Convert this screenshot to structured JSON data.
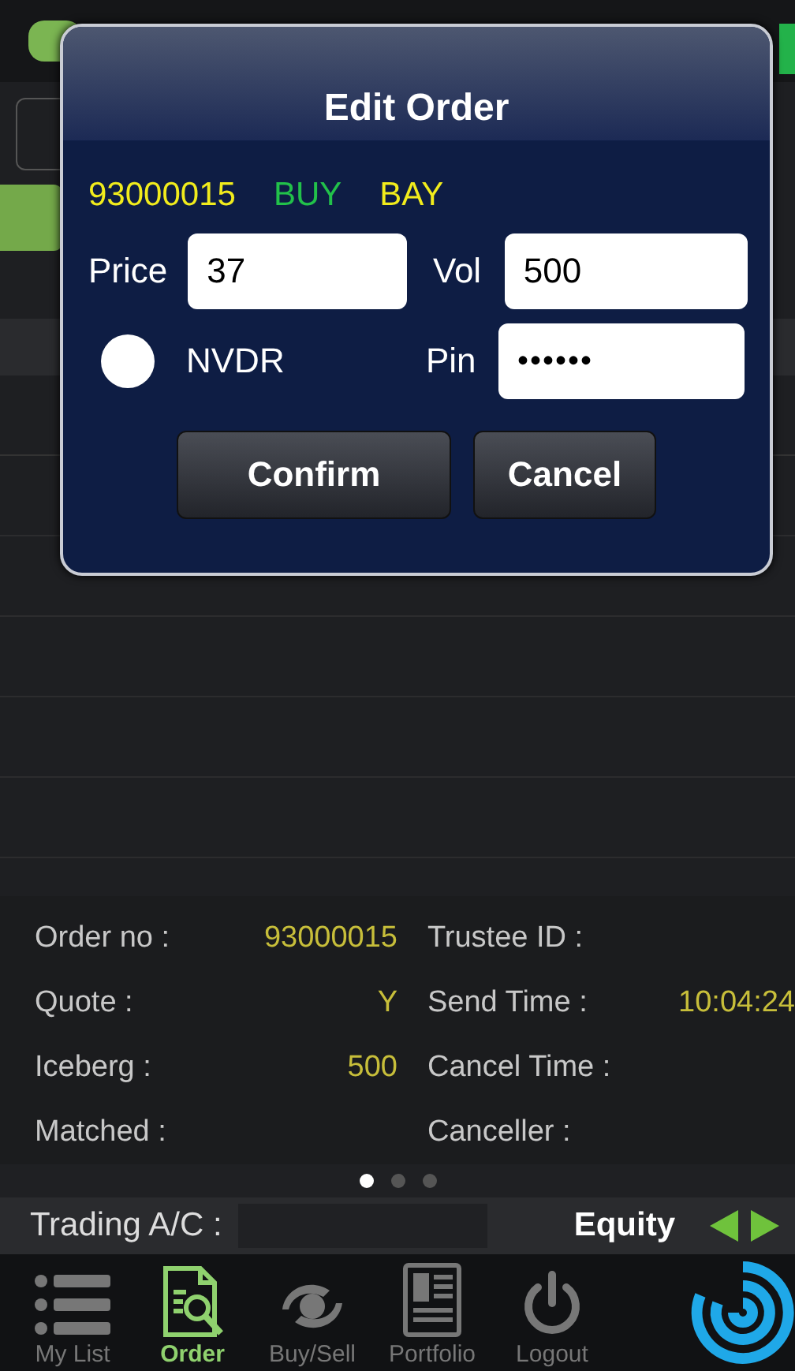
{
  "dialog": {
    "title": "Edit Order",
    "order_no": "93000015",
    "side": "BUY",
    "symbol": "BAY",
    "price": {
      "label": "Price",
      "value": "37"
    },
    "volume": {
      "label": "Vol",
      "value": "500"
    },
    "nvdr": {
      "label": "NVDR",
      "checked": false
    },
    "pin": {
      "label": "Pin",
      "value": "••••••"
    },
    "buttons": [
      "Confirm",
      "Cancel"
    ]
  },
  "details": [
    {
      "label": "Order no :",
      "value": "93000015",
      "label_2": "Trustee ID :"
    },
    {
      "label": "Quote :",
      "value": "Y",
      "label_2": "Send Time :",
      "value_2": "10:04:24"
    },
    {
      "label": "Iceberg :",
      "value": "500",
      "label_2": "Cancel Time :"
    },
    {
      "label": "Matched :",
      "label_2": "Canceller :"
    }
  ],
  "pages": [
    {
      "selected": true
    },
    {
      "selected": false
    },
    {
      "selected": false
    }
  ],
  "account": {
    "label": "Trading A/C :",
    "value": "Equity"
  },
  "tabs": [
    {
      "label": "My List",
      "selected": false
    },
    {
      "label": "Order",
      "selected": true
    },
    {
      "label": "Buy/Sell",
      "selected": false
    },
    {
      "label": "Portfolio",
      "selected": false
    },
    {
      "label": "Logout",
      "selected": false
    }
  ]
}
